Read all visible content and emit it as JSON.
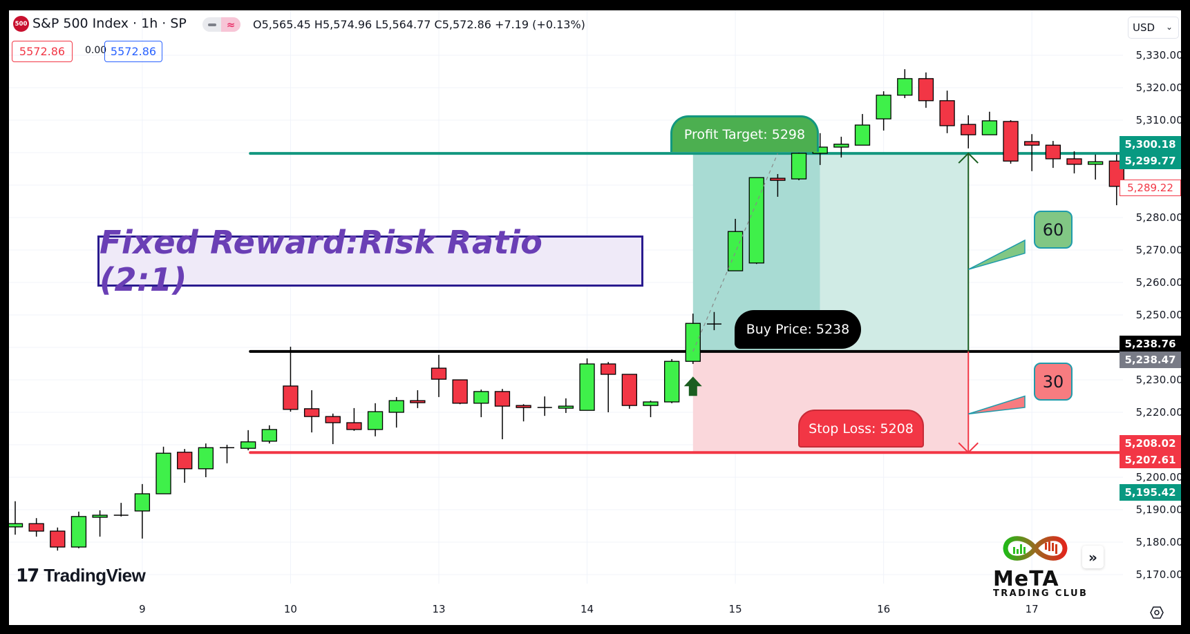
{
  "header": {
    "symbol_badge": "500",
    "title": "S&P 500 Index · 1h · SP",
    "ohlc": "O5,565.45 H5,574.96 L5,564.77 C5,572.86 +7.19 (+0.13%)",
    "sell_price": "5572.86",
    "spread": "0.00",
    "buy_price": "5572.86",
    "currency": "USD"
  },
  "annotation": {
    "title": "Fixed Reward:Risk Ratio (2:1)",
    "profit_label": "Profit Target: 5298",
    "buy_label": "Buy Price: 5238",
    "stop_label": "Stop Loss: 5208",
    "reward_callout": "60",
    "risk_callout": "30"
  },
  "branding": {
    "tv_mark": "17",
    "tv_word": "TradingView",
    "club_word": "MeTA",
    "club_sub": "TRADING CLUB"
  },
  "price_badges": [
    {
      "text": "5,300.18",
      "value": 5300.18,
      "bg": "#089981",
      "fg": "#ffffff",
      "group": "top"
    },
    {
      "text": "5,299.77",
      "value": 5299.77,
      "bg": "#089981",
      "fg": "#ffffff",
      "group": "bottom"
    },
    {
      "text": "5,289.22",
      "value": 5289.22,
      "bg": "#ffffff",
      "fg": "#f23645",
      "border": "#f23645",
      "group": "single"
    },
    {
      "text": "5,238.76",
      "value": 5238.76,
      "bg": "#000000",
      "fg": "#ffffff",
      "group": "top"
    },
    {
      "text": "5,238.47",
      "value": 5238.47,
      "bg": "#787b86",
      "fg": "#ffffff",
      "group": "bottom"
    },
    {
      "text": "5,208.02",
      "value": 5208.02,
      "bg": "#f23645",
      "fg": "#ffffff",
      "group": "top"
    },
    {
      "text": "5,207.61",
      "value": 5207.61,
      "bg": "#f23645",
      "fg": "#ffffff",
      "group": "bottom"
    },
    {
      "text": "5,195.42",
      "value": 5195.42,
      "bg": "#089981",
      "fg": "#ffffff",
      "group": "single"
    }
  ],
  "colors": {
    "up": "#3ff04a",
    "down": "#f23645",
    "profit_line": "#12977f",
    "buy_line": "#000000",
    "stop_line": "#f23645",
    "profit_zone_dark": "#a8dbd3",
    "profit_zone_light": "#d0ebe5",
    "loss_zone": "#fad7db"
  },
  "chart_data": {
    "type": "candlestick",
    "title": "S&P 500 Index · 1h · SP",
    "ylabel": "USD",
    "ylim": [
      5162,
      5334
    ],
    "yticks": [
      5330,
      5320,
      5310,
      5300,
      5290,
      5280,
      5270,
      5260,
      5250,
      5240,
      5230,
      5220,
      5210,
      5200,
      5190,
      5180,
      5170
    ],
    "ytick_labels": [
      "5,330.00",
      "5,320.00",
      "5,310.00",
      "5,300.00",
      "5,290.00",
      "5,280.00",
      "5,270.00",
      "5,260.00",
      "5,250.00",
      "5,240.00",
      "5,230.00",
      "5,220.00",
      "5,210.00",
      "5,200.00",
      "5,190.00",
      "5,180.00",
      "5,170.00"
    ],
    "xticks": [
      {
        "index": 6,
        "label": "9"
      },
      {
        "index": 13,
        "label": "10"
      },
      {
        "index": 20,
        "label": "13"
      },
      {
        "index": 27,
        "label": "14"
      },
      {
        "index": 34,
        "label": "15"
      },
      {
        "index": 41,
        "label": "16"
      },
      {
        "index": 48,
        "label": "17"
      }
    ],
    "grid": true,
    "candles": [
      {
        "o": 5184.7,
        "h": 5192.6,
        "l": 5182.3,
        "c": 5185.7
      },
      {
        "o": 5185.7,
        "h": 5187.4,
        "l": 5181.7,
        "c": 5183.4
      },
      {
        "o": 5183.4,
        "h": 5184.5,
        "l": 5177.4,
        "c": 5178.5
      },
      {
        "o": 5178.5,
        "h": 5189.4,
        "l": 5178.1,
        "c": 5187.9
      },
      {
        "o": 5187.9,
        "h": 5189.8,
        "l": 5181.7,
        "c": 5188.3
      },
      {
        "o": 5188.3,
        "h": 5192.1,
        "l": 5187.9,
        "c": 5188.3
      },
      {
        "o": 5189.6,
        "h": 5197.9,
        "l": 5181.1,
        "c": 5194.9
      },
      {
        "o": 5194.9,
        "h": 5209.4,
        "l": 5194.9,
        "c": 5207.4
      },
      {
        "o": 5207.7,
        "h": 5208.7,
        "l": 5198.3,
        "c": 5202.6
      },
      {
        "o": 5202.6,
        "h": 5210.4,
        "l": 5200.0,
        "c": 5209.1
      },
      {
        "o": 5209.1,
        "h": 5210.0,
        "l": 5204.3,
        "c": 5209.1
      },
      {
        "o": 5208.9,
        "h": 5214.5,
        "l": 5208.3,
        "c": 5210.9
      },
      {
        "o": 5211.1,
        "h": 5216.0,
        "l": 5210.4,
        "c": 5214.7
      },
      {
        "o": 5228.1,
        "h": 5240.2,
        "l": 5220.2,
        "c": 5220.9
      },
      {
        "o": 5221.1,
        "h": 5226.8,
        "l": 5213.8,
        "c": 5218.7
      },
      {
        "o": 5218.7,
        "h": 5219.6,
        "l": 5210.2,
        "c": 5216.8
      },
      {
        "o": 5216.8,
        "h": 5221.3,
        "l": 5214.3,
        "c": 5214.7
      },
      {
        "o": 5214.7,
        "h": 5222.8,
        "l": 5212.6,
        "c": 5220.2
      },
      {
        "o": 5220.0,
        "h": 5224.7,
        "l": 5215.3,
        "c": 5223.6
      },
      {
        "o": 5223.6,
        "h": 5226.8,
        "l": 5221.3,
        "c": 5223.2
      },
      {
        "o": 5233.6,
        "h": 5237.7,
        "l": 5224.7,
        "c": 5230.2
      },
      {
        "o": 5230.0,
        "h": 5230.0,
        "l": 5222.5,
        "c": 5222.8
      },
      {
        "o": 5222.8,
        "h": 5227.0,
        "l": 5218.5,
        "c": 5226.4
      },
      {
        "o": 5226.4,
        "h": 5227.2,
        "l": 5211.7,
        "c": 5221.9
      },
      {
        "o": 5222.1,
        "h": 5222.5,
        "l": 5217.2,
        "c": 5221.5
      },
      {
        "o": 5221.5,
        "h": 5224.9,
        "l": 5218.9,
        "c": 5221.5
      },
      {
        "o": 5221.5,
        "h": 5224.3,
        "l": 5219.8,
        "c": 5221.9
      },
      {
        "o": 5220.6,
        "h": 5236.6,
        "l": 5220.6,
        "c": 5234.9
      },
      {
        "o": 5234.9,
        "h": 5235.5,
        "l": 5220.0,
        "c": 5231.7
      },
      {
        "o": 5231.7,
        "h": 5231.7,
        "l": 5221.1,
        "c": 5222.1
      },
      {
        "o": 5222.1,
        "h": 5223.6,
        "l": 5218.5,
        "c": 5223.2
      },
      {
        "o": 5223.2,
        "h": 5236.4,
        "l": 5222.8,
        "c": 5235.7
      },
      {
        "o": 5235.7,
        "h": 5250.4,
        "l": 5234.9,
        "c": 5247.4
      },
      {
        "o": 5247.2,
        "h": 5250.9,
        "l": 5245.3,
        "c": 5247.2
      },
      {
        "o": 5263.6,
        "h": 5279.6,
        "l": 5263.6,
        "c": 5275.7
      },
      {
        "o": 5266.0,
        "h": 5292.3,
        "l": 5265.7,
        "c": 5292.3
      },
      {
        "o": 5292.1,
        "h": 5293.4,
        "l": 5286.4,
        "c": 5291.7
      },
      {
        "o": 5291.9,
        "h": 5300.0,
        "l": 5291.5,
        "c": 5299.8
      },
      {
        "o": 5299.8,
        "h": 5306.0,
        "l": 5296.2,
        "c": 5301.7
      },
      {
        "o": 5301.7,
        "h": 5304.9,
        "l": 5298.5,
        "c": 5302.6
      },
      {
        "o": 5302.3,
        "h": 5311.9,
        "l": 5302.3,
        "c": 5308.5
      },
      {
        "o": 5310.4,
        "h": 5318.9,
        "l": 5306.8,
        "c": 5317.7
      },
      {
        "o": 5317.7,
        "h": 5325.7,
        "l": 5316.8,
        "c": 5322.8
      },
      {
        "o": 5322.8,
        "h": 5324.7,
        "l": 5313.8,
        "c": 5316.0
      },
      {
        "o": 5316.0,
        "h": 5319.1,
        "l": 5306.0,
        "c": 5308.3
      },
      {
        "o": 5308.7,
        "h": 5311.5,
        "l": 5301.3,
        "c": 5305.5
      },
      {
        "o": 5305.5,
        "h": 5312.6,
        "l": 5305.5,
        "c": 5309.8
      },
      {
        "o": 5309.6,
        "h": 5310.0,
        "l": 5296.6,
        "c": 5297.4
      },
      {
        "o": 5303.4,
        "h": 5305.7,
        "l": 5294.3,
        "c": 5302.3
      },
      {
        "o": 5302.3,
        "h": 5303.6,
        "l": 5295.3,
        "c": 5298.1
      },
      {
        "o": 5298.1,
        "h": 5300.4,
        "l": 5293.6,
        "c": 5296.4
      },
      {
        "o": 5296.4,
        "h": 5299.4,
        "l": 5291.7,
        "c": 5297.2
      },
      {
        "o": 5297.4,
        "h": 5299.4,
        "l": 5283.8,
        "c": 5289.6
      }
    ],
    "levels": {
      "profit_target": 5299.77,
      "entry": 5238.76,
      "stop_loss": 5207.61,
      "level_start_index": 11.1
    },
    "position_tool": {
      "start_index": 32,
      "dark_end_index": 38,
      "end_index": 45,
      "entry_marker_index": 32
    }
  }
}
